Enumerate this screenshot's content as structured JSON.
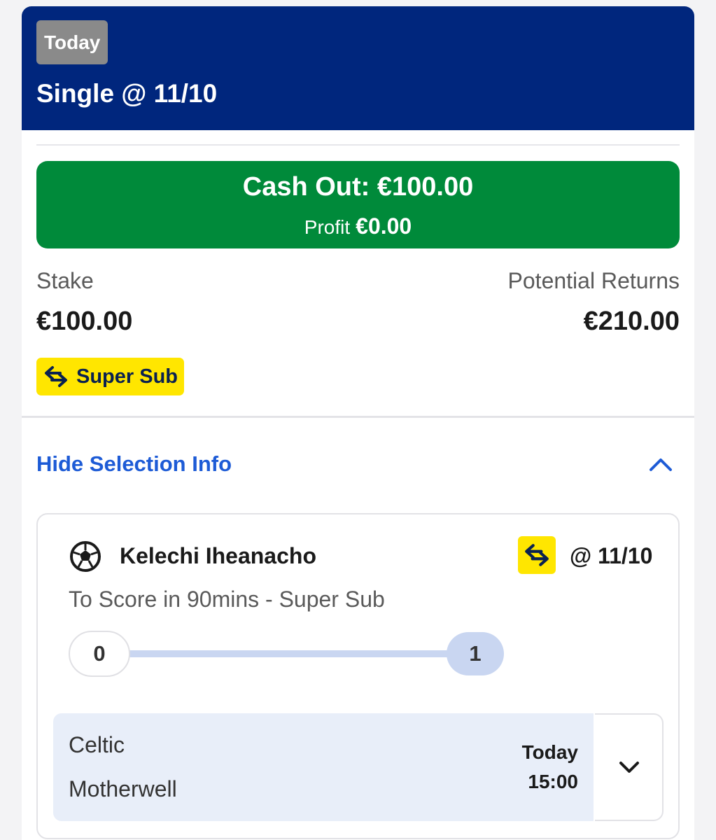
{
  "header": {
    "badge": "Today",
    "title": "Single @ 11/10"
  },
  "cash_out": {
    "label": "Cash Out: €100.00",
    "profit_label": "Profit",
    "profit_value": "€0.00"
  },
  "stake": {
    "label": "Stake",
    "value": "€100.00"
  },
  "returns": {
    "label": "Potential Returns",
    "value": "€210.00"
  },
  "super_sub_badge": {
    "label": "Super Sub",
    "icon": "swap-arrows-icon"
  },
  "selection_toggle": {
    "label": "Hide Selection Info",
    "icon": "chevron-up-icon"
  },
  "selection": {
    "sport_icon": "football-icon",
    "player": "Kelechi Iheanacho",
    "odds": "@ 11/10",
    "market": "To Score in 90mins - Super Sub",
    "progress": {
      "start": "0",
      "end": "1",
      "fraction": 1.0
    }
  },
  "event": {
    "home": "Celtic",
    "away": "Motherwell",
    "day": "Today",
    "time": "15:00",
    "expand_icon": "chevron-down-icon"
  },
  "colors": {
    "header_bg": "#00267d",
    "cash_out_bg": "#008a3a",
    "super_sub_yellow": "#ffe600",
    "link_blue": "#1d5bd6",
    "progress_blue": "#c9d6f1",
    "event_bg": "#e8eef9"
  }
}
